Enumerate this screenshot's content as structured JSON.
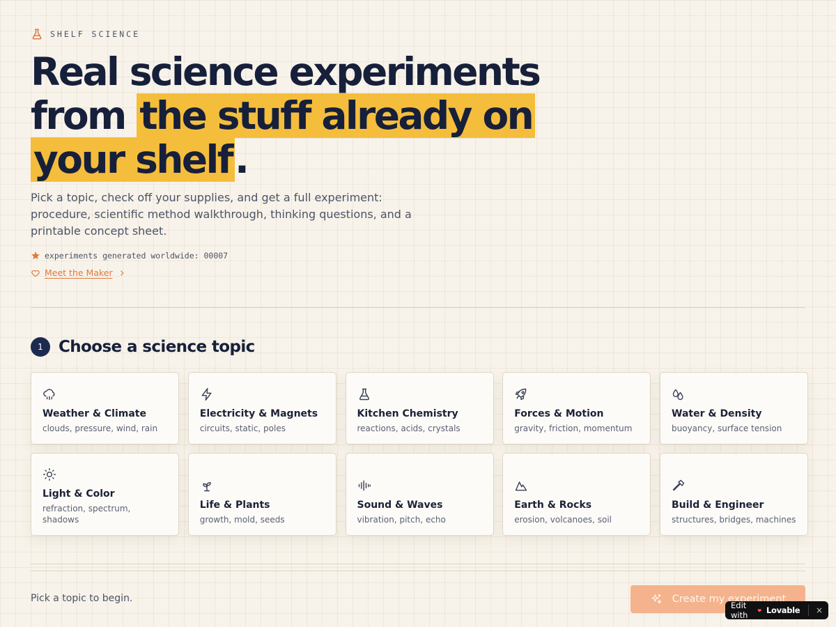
{
  "brand": {
    "label": "SHELF SCIENCE",
    "icon": "flask-icon",
    "accent": "#e0793d"
  },
  "hero": {
    "line1": "Real science experiments",
    "line2_plain": "from",
    "line2_highlight": "the stuff already on",
    "line3_highlight": "your shelf",
    "line3_tail": ".",
    "highlight_color": "#f5bd3c"
  },
  "lead": "Pick a topic, check off your supplies, and get a full experiment: procedure, scientific method walkthrough, thinking questions, and a printable concept sheet.",
  "counter": {
    "text": "experiments generated worldwide: 00007",
    "icon": "star-icon"
  },
  "maker": {
    "label": "Meet the Maker",
    "icon": "heart-icon"
  },
  "step": {
    "number": "1",
    "title": "Choose a science topic"
  },
  "topics": [
    {
      "title": "Weather & Climate",
      "sub": "clouds, pressure, wind, rain",
      "icon": "cloud-rain-icon"
    },
    {
      "title": "Electricity & Magnets",
      "sub": "circuits, static, poles",
      "icon": "lightning-icon"
    },
    {
      "title": "Kitchen Chemistry",
      "sub": "reactions, acids, crystals",
      "icon": "flask-icon"
    },
    {
      "title": "Forces & Motion",
      "sub": "gravity, friction, momentum",
      "icon": "rocket-icon"
    },
    {
      "title": "Water & Density",
      "sub": "buoyancy, surface tension",
      "icon": "droplets-icon"
    },
    {
      "title": "Light & Color",
      "sub": "refraction, spectrum, shadows",
      "icon": "sun-icon"
    },
    {
      "title": "Life & Plants",
      "sub": "growth, mold, seeds",
      "icon": "sprout-icon"
    },
    {
      "title": "Sound & Waves",
      "sub": "vibration, pitch, echo",
      "icon": "audio-wave-icon"
    },
    {
      "title": "Earth & Rocks",
      "sub": "erosion, volcanoes, soil",
      "icon": "mountain-icon"
    },
    {
      "title": "Build & Engineer",
      "sub": "structures, bridges, machines",
      "icon": "hammer-icon"
    }
  ],
  "footer": {
    "message": "Pick a topic to begin.",
    "cta_label": "Create my experiment",
    "cta_icon": "sparkles-icon",
    "cta_color": "#f4b38d"
  },
  "badge": {
    "prefix": "Edit with",
    "logo": "Lovable",
    "close": "×"
  }
}
